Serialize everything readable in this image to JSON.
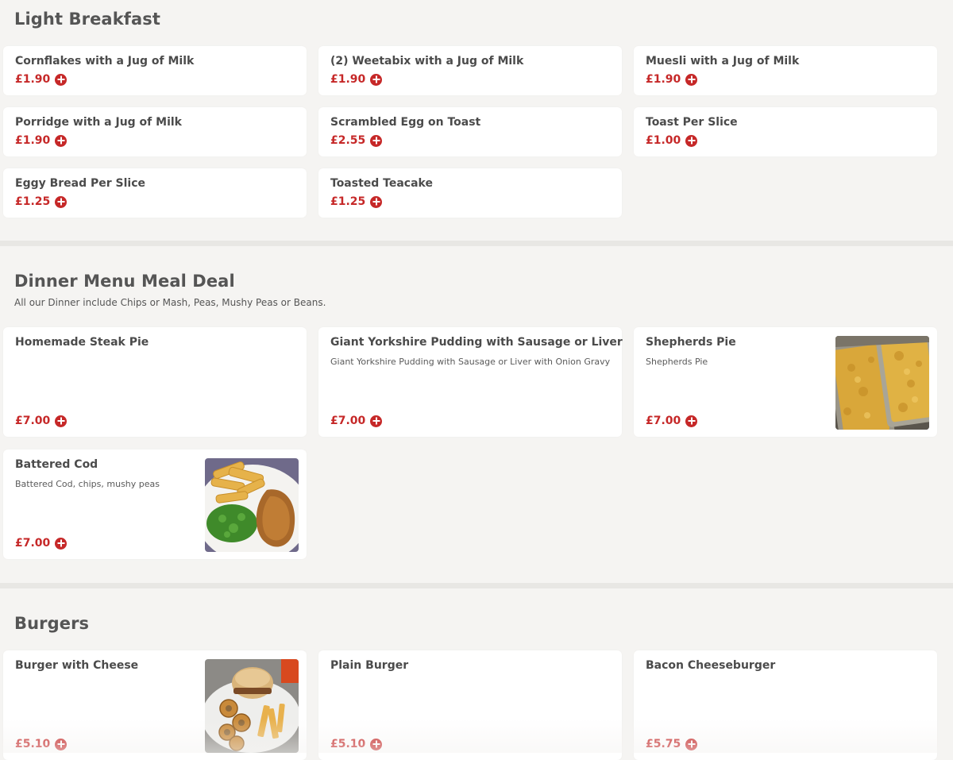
{
  "sections": {
    "light_breakfast": {
      "title": "Light Breakfast",
      "items": [
        {
          "name": "Cornflakes with a Jug of Milk",
          "price": "£1.90"
        },
        {
          "name": "(2) Weetabix with a Jug of Milk",
          "price": "£1.90"
        },
        {
          "name": "Muesli with a Jug of Milk",
          "price": "£1.90"
        },
        {
          "name": "Porridge with a Jug of Milk",
          "price": "£1.90"
        },
        {
          "name": "Scrambled Egg on Toast",
          "price": "£2.55"
        },
        {
          "name": "Toast Per Slice",
          "price": "£1.00"
        },
        {
          "name": "Eggy Bread Per Slice",
          "price": "£1.25"
        },
        {
          "name": "Toasted Teacake",
          "price": "£1.25"
        }
      ]
    },
    "dinner_menu": {
      "title": "Dinner Menu Meal Deal",
      "description": "All our Dinner include Chips or Mash, Peas, Mushy Peas or Beans.",
      "items": [
        {
          "name": "Homemade Steak Pie",
          "description": "",
          "price": "£7.00"
        },
        {
          "name": "Giant Yorkshire Pudding with Sausage or Liver",
          "description": "Giant Yorkshire Pudding with Sausage or Liver with Onion Gravy",
          "price": "£7.00"
        },
        {
          "name": "Shepherds Pie",
          "description": "Shepherds Pie",
          "price": "£7.00",
          "image": "shepherds-pie-photo"
        },
        {
          "name": "Battered Cod",
          "description": "Battered Cod, chips, mushy peas",
          "price": "£7.00",
          "image": "battered-cod-photo"
        }
      ]
    },
    "burgers": {
      "title": "Burgers",
      "items": [
        {
          "name": "Burger with Cheese",
          "price": "£5.10",
          "image": "burger-photo"
        },
        {
          "name": "Plain Burger",
          "price": "£5.10"
        },
        {
          "name": "Bacon Cheeseburger",
          "price": "£5.75"
        }
      ]
    }
  },
  "icons": {
    "add": "plus-circle-icon"
  },
  "colors": {
    "accent": "#c62828",
    "background": "#f5f4f2",
    "card": "#ffffff"
  }
}
